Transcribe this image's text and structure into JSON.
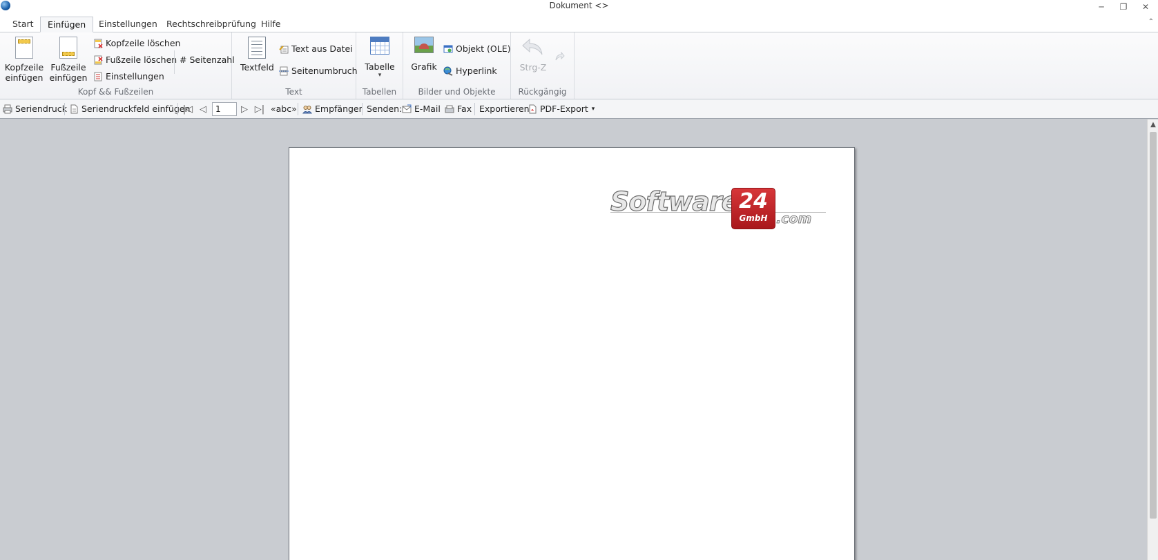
{
  "window": {
    "title": "Dokument <>",
    "minimize_glyph": "─",
    "maximize_glyph": "❐",
    "close_glyph": "✕"
  },
  "tabs": [
    {
      "label": "Start",
      "active": false
    },
    {
      "label": "Einfügen",
      "active": true
    },
    {
      "label": "Einstellungen",
      "active": false
    },
    {
      "label": "Rechtschreibprüfung",
      "active": false
    },
    {
      "label": "Hilfe",
      "active": false
    }
  ],
  "ribbon": {
    "collapse_glyph": "⌃",
    "header_footer": {
      "group_label": "Kopf && Fußzeilen",
      "insert_header": [
        "Kopfzeile",
        "einfügen"
      ],
      "insert_footer": [
        "Fußzeile",
        "einfügen"
      ],
      "delete_header": "Kopfzeile löschen",
      "delete_footer": "Fußzeile löschen",
      "settings": "Einstellungen",
      "page_number": "# Seitenzahl"
    },
    "text": {
      "group_label": "Text",
      "textfield": "Textfeld",
      "text_from_file": "Text aus Datei",
      "page_break": "Seitenumbruch"
    },
    "tables": {
      "group_label": "Tabellen",
      "table": "Tabelle",
      "dropdown_glyph": "▾"
    },
    "images_objects": {
      "group_label": "Bilder und Objekte",
      "graphic": "Grafik",
      "object_ole": "Objekt (OLE)",
      "hyperlink": "Hyperlink"
    },
    "undo": {
      "group_label": "Rückgängig",
      "undo": "Strg-Z"
    }
  },
  "toolbar": {
    "mail_merge": "Seriendruck",
    "insert_merge_field": "Seriendruckfeld einfügen",
    "page_value": "1",
    "first_glyph": "|◁",
    "prev_glyph": "◁",
    "next_glyph": "▷",
    "last_glyph": "▷|",
    "abc": "«abc»",
    "recipients": "Empfänger",
    "send_label": "Senden:",
    "email": "E-Mail",
    "fax": "Fax",
    "export_label": "Exportieren:",
    "pdf_export": "PDF-Export",
    "dropdown_glyph": "▾"
  },
  "document": {
    "logo": {
      "word": "Software",
      "number": "24",
      "company": "GmbH",
      "domain": ".com"
    }
  },
  "scrollbar": {
    "up_glyph": "▲"
  },
  "colors": {
    "accent": "#1b5fa8",
    "logo_red": "#c0282c",
    "canvas": "#c9ccd1"
  }
}
